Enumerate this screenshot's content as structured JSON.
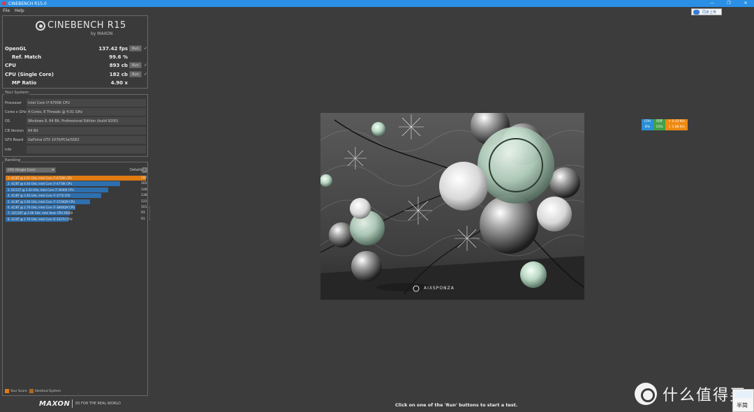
{
  "window": {
    "title": "CINEBENCH R15.0",
    "buttons": [
      "—",
      "❐",
      "✕"
    ]
  },
  "menu": [
    "File",
    "Help"
  ],
  "logo": {
    "name": "CINEBENCH R15",
    "sub": "by MAXON"
  },
  "scores": [
    {
      "label": "OpenGL",
      "value": "137.42 fps",
      "run": "Run",
      "checked": true,
      "indent": false
    },
    {
      "label": "Ref. Match",
      "value": "99.6 %",
      "run": null,
      "checked": false,
      "indent": true
    },
    {
      "label": "CPU",
      "value": "893 cb",
      "run": "Run",
      "checked": true,
      "indent": false
    },
    {
      "label": "CPU (Single Core)",
      "value": "182 cb",
      "run": "Run",
      "checked": true,
      "indent": false
    },
    {
      "label": "MP Ratio",
      "value": "4.90 x",
      "run": null,
      "checked": false,
      "indent": true
    }
  ],
  "system": {
    "title": "Your System",
    "rows": [
      {
        "key": "Processor",
        "value": "Intel Core i7-6700K CPU"
      },
      {
        "key": "Cores x GHz",
        "value": "4 Cores, 8 Threads @ 4.01 GHz"
      },
      {
        "key": "OS",
        "value": "Windows 8, 64 Bit, Professional Edition (build 9200)"
      },
      {
        "key": "CB Version",
        "value": "64 Bit"
      },
      {
        "key": "GFX Board",
        "value": "GeForce GTX 1070/PCIe/SSE2"
      },
      {
        "key": "Info",
        "value": ""
      }
    ]
  },
  "ranking": {
    "title": "Ranking",
    "selected": "CPU (Single Core)",
    "details_label": "Details",
    "max_score": 182,
    "items": [
      {
        "label": "1. 4C/8T @ 4.01 GHz, Intel Core i7-6700K CPU",
        "score": 182,
        "highlight": true
      },
      {
        "label": "2. 4C/8T @ 4.40 GHz, Intel Core i7-4770K CPU",
        "score": 165,
        "highlight": false
      },
      {
        "label": "3. 6C/12T @ 3.30 GHz, Intel Core i7-3930K CPU",
        "score": 148,
        "highlight": false
      },
      {
        "label": "4. 4C/8T @ 3.40 GHz, Intel Core i7-3770 CPU",
        "score": 138,
        "highlight": false
      },
      {
        "label": "5. 4C/8T @ 2.60 GHz, Intel Core i7-3720QM CPU",
        "score": 122,
        "highlight": false
      },
      {
        "label": "6. 4C/8T @ 2.79 GHz, Intel Core i7-3840QM CPU",
        "score": 101,
        "highlight": false
      },
      {
        "label": "7. 12C/24T @ 2.66 GHz, Intel Xeon CPU X5650",
        "score": 93,
        "highlight": false
      },
      {
        "label": "8. 2C/4T @ 1.70 GHz, Intel Core i5-3317U CPU",
        "score": 91,
        "highlight": false
      }
    ],
    "legend": {
      "yours": "Your Score",
      "identical": "Identical System"
    }
  },
  "footer": {
    "brand": "MAXON",
    "tagline": "3D FOR THE REAL WORLD"
  },
  "render": {
    "label": "AIXSPONZA"
  },
  "cloud": {
    "label": "同步上传"
  },
  "monitor": {
    "cpu_label": "CPU",
    "cpu_value": "8%",
    "mem_label": "内存",
    "mem_value": "15%",
    "up": "0.33 K/s",
    "down": "1.88 K/s"
  },
  "status": "Click on one of the 'Run' buttons to start a test.",
  "watermark": "什么值得买",
  "ime": "半简"
}
